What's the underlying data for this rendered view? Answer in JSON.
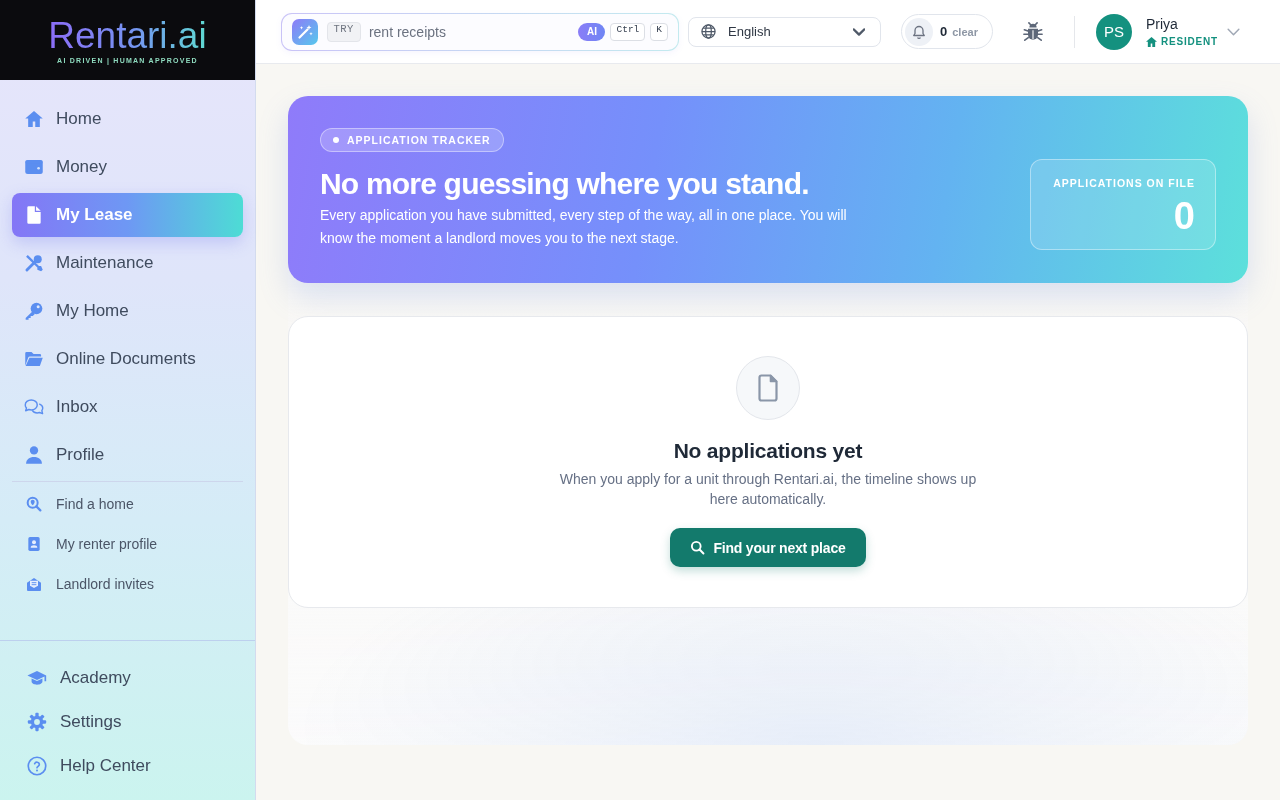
{
  "sidebar": {
    "logo": {
      "wordmark": "Rentari.ai",
      "tagline": "AI DRIVEN | HUMAN APPROVED"
    },
    "nav_items": [
      {
        "label": "Home",
        "selected": false
      },
      {
        "label": "Money",
        "selected": false
      },
      {
        "label": "My Lease",
        "selected": true
      },
      {
        "label": "Maintenance",
        "selected": false
      },
      {
        "label": "My Home",
        "selected": false
      },
      {
        "label": "Online Documents",
        "selected": false
      },
      {
        "label": "Inbox",
        "selected": false
      },
      {
        "label": "Profile",
        "selected": false
      }
    ],
    "secondary_items": [
      {
        "label": "Find a home",
        "selected": false
      },
      {
        "label": "My renter profile",
        "selected": false
      },
      {
        "label": "Landlord invites",
        "selected": false
      }
    ],
    "footer_items": [
      {
        "label": "Academy",
        "selected": false
      },
      {
        "label": "Settings",
        "selected": false
      },
      {
        "label": "Help Center",
        "selected": false
      }
    ]
  },
  "top_bar": {
    "search": {
      "tag": "TRY",
      "placeholder": "rent receipts",
      "ai_badge": "AI",
      "shortcut_keys": [
        "Ctrl",
        "K"
      ]
    },
    "language_select": {
      "value": "English"
    },
    "notifications": {
      "count": "0",
      "action": "clear"
    },
    "user": {
      "initials": "PS",
      "name": "Priya",
      "role": "RESIDENT"
    }
  },
  "banner": {
    "tag": "APPLICATION TRACKER",
    "title": "No more guessing where you stand.",
    "description": "Every application you have submitted, every step of the way, all in one place. You will know the moment a landlord moves you to the next stage.",
    "stat": {
      "label": "APPLICATIONS ON FILE",
      "value": "0"
    }
  },
  "empty_state": {
    "title": "No applications yet",
    "description": "When you apply for a unit through Rentari.ai, the timeline shows up here automatically.",
    "button": "Find your next place"
  }
}
